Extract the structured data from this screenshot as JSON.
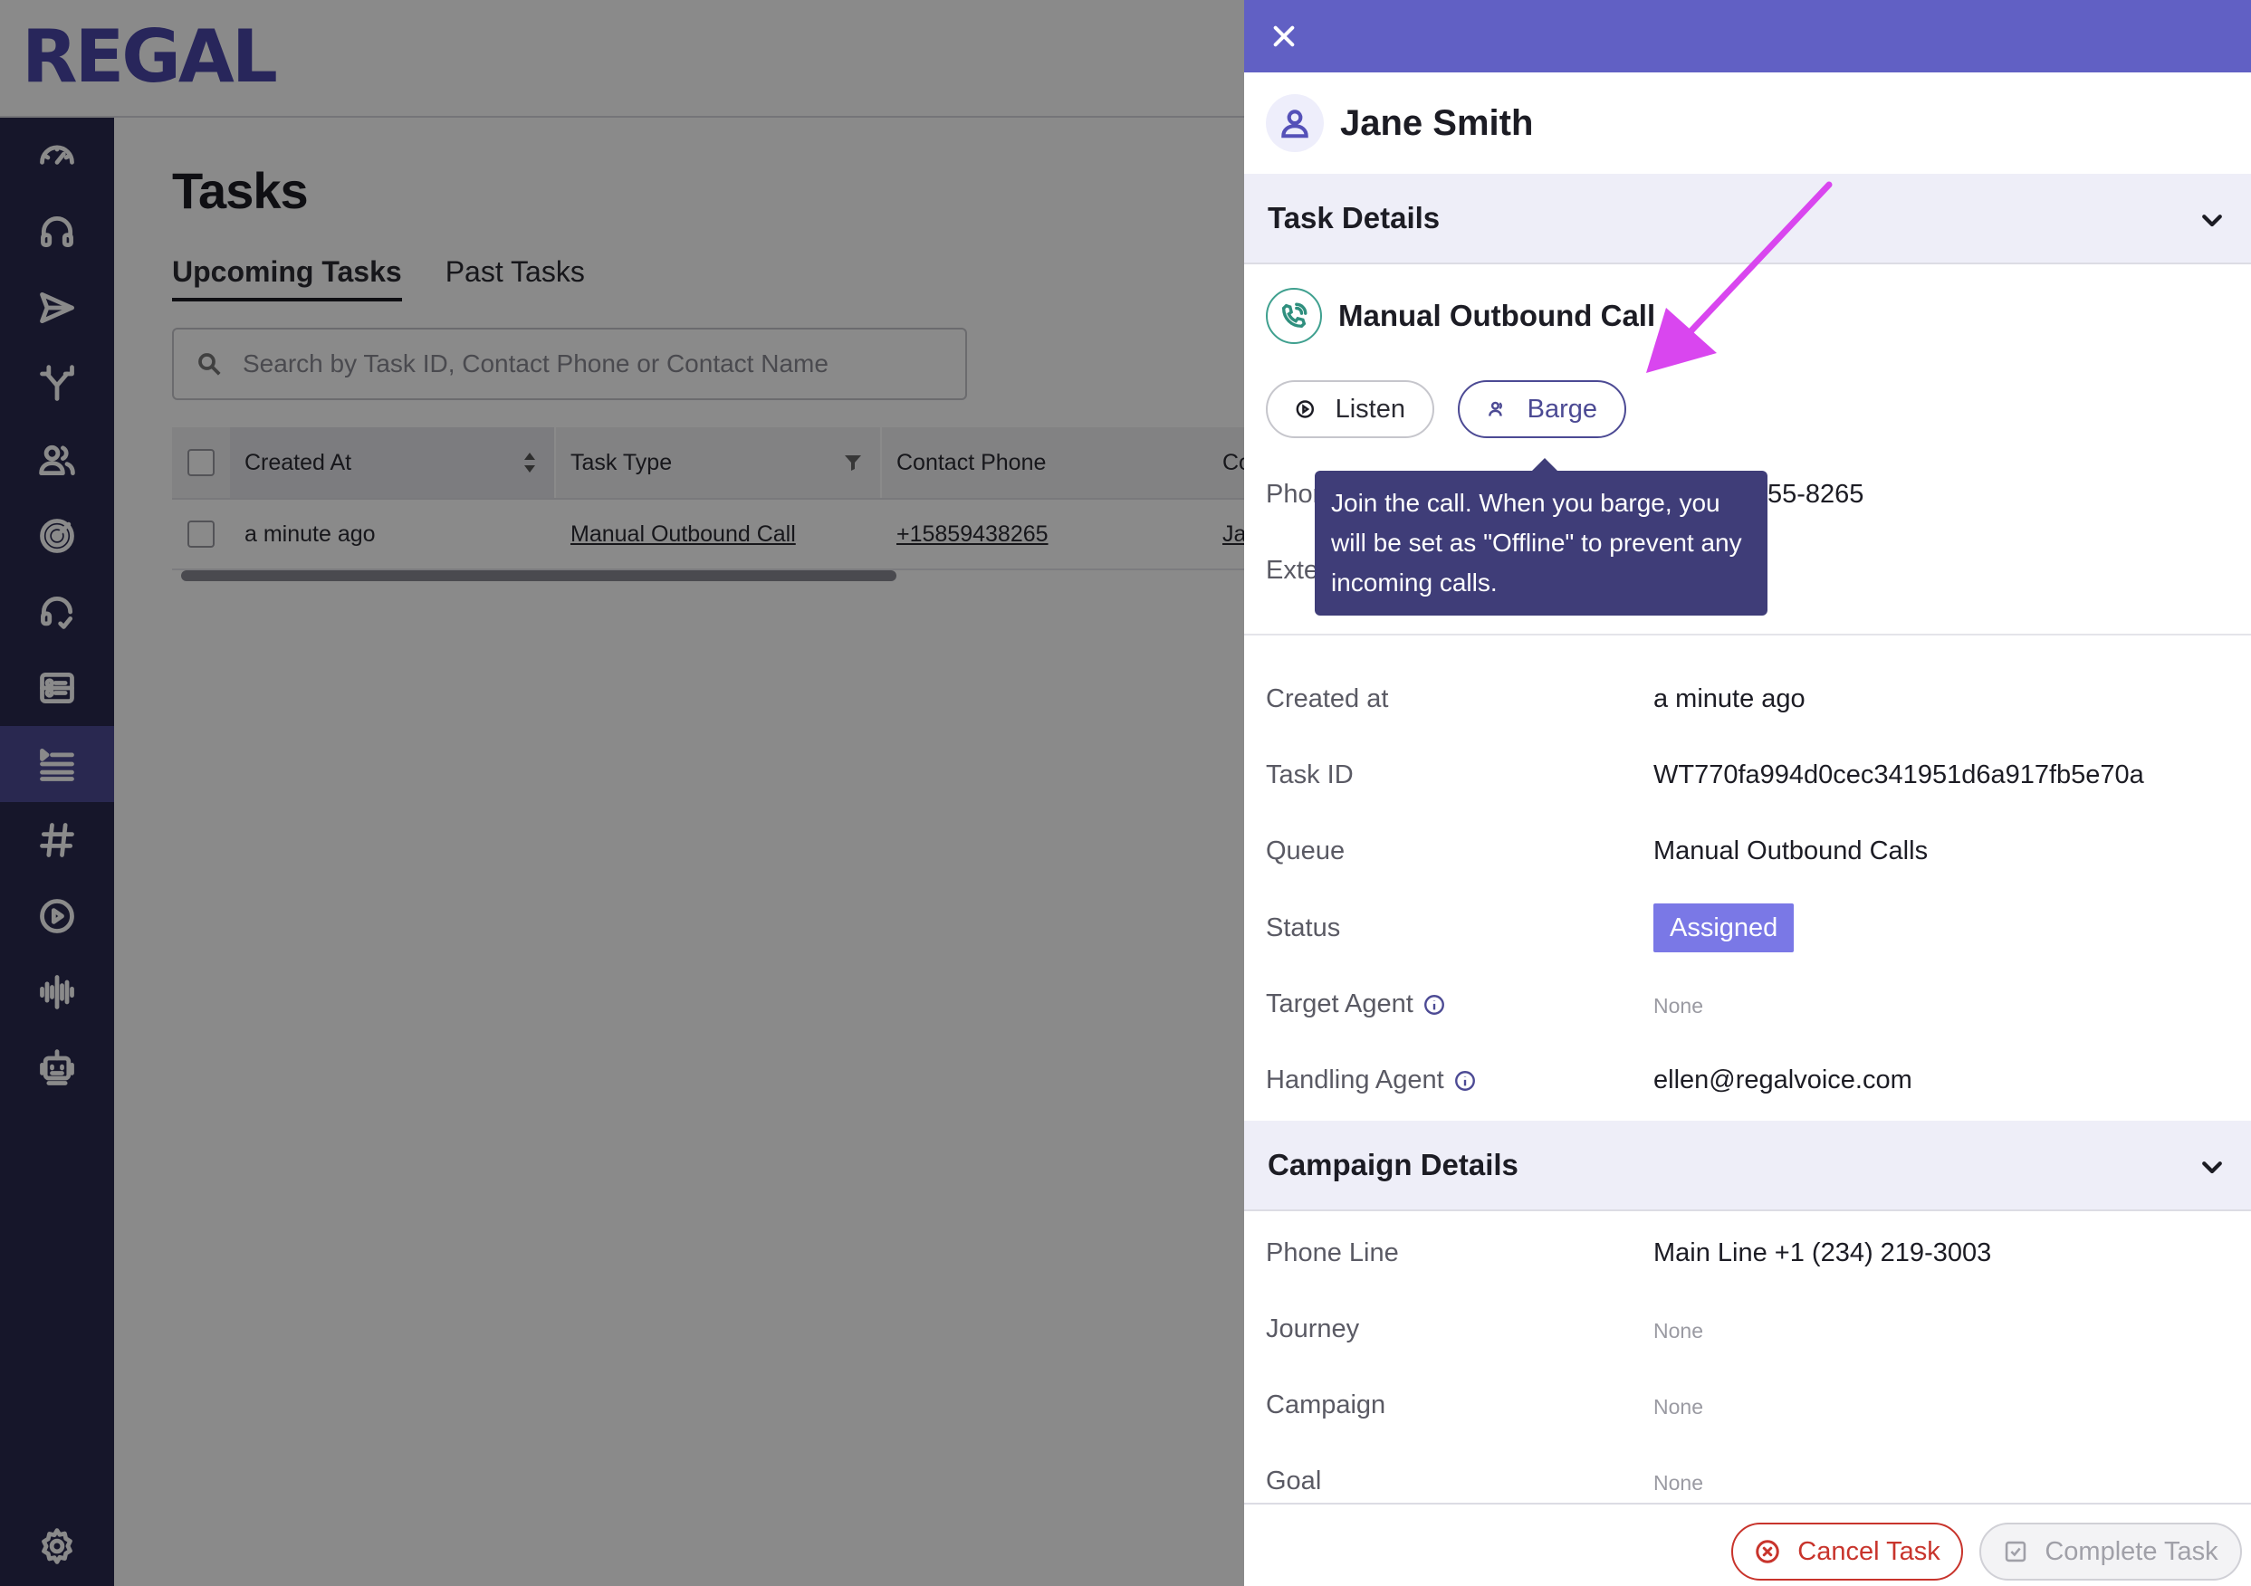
{
  "app": {
    "logo": "REGAL"
  },
  "sidebar": {
    "items": [
      {
        "icon": "dashboard-gauge-icon"
      },
      {
        "icon": "headset-icon"
      },
      {
        "icon": "send-icon"
      },
      {
        "icon": "branch-icon"
      },
      {
        "icon": "contacts-icon"
      },
      {
        "icon": "target-icon"
      },
      {
        "icon": "agent-headset-icon"
      },
      {
        "icon": "reports-icon"
      },
      {
        "icon": "tasks-list-icon",
        "active": true
      },
      {
        "icon": "hashtag-icon"
      },
      {
        "icon": "play-circle-icon"
      },
      {
        "icon": "audio-wave-icon"
      },
      {
        "icon": "robot-icon"
      },
      {
        "icon": "settings-gear-icon"
      }
    ]
  },
  "main": {
    "title": "Tasks",
    "tabs": [
      {
        "label": "Upcoming Tasks",
        "active": true
      },
      {
        "label": "Past Tasks",
        "active": false
      }
    ],
    "search": {
      "placeholder": "Search by Task ID, Contact Phone or Contact Name",
      "value": ""
    },
    "table": {
      "headers": [
        "Created At",
        "Task Type",
        "Contact Phone",
        "Co"
      ],
      "rows": [
        {
          "created_at": "a minute ago",
          "task_type": "Manual Outbound Call",
          "contact_phone": "+15859438265",
          "contact": "Ja"
        }
      ]
    }
  },
  "drawer": {
    "contact_name": "Jane Smith",
    "task_details": {
      "title": "Task Details",
      "task_kind": "Manual Outbound Call",
      "listen_label": "Listen",
      "barge_label": "Barge",
      "tooltip": "Join the call. When you barge, you will be set as \"Offline\" to prevent any incoming calls.",
      "phone_label_fragment": "Phor",
      "phone_value_fragment": "55-8265",
      "ext_label_fragment": "Exte"
    },
    "fields": {
      "created_at": {
        "label": "Created at",
        "value": "a minute ago"
      },
      "task_id": {
        "label": "Task ID",
        "value": "WT770fa994d0cec341951d6a917fb5e70a"
      },
      "queue": {
        "label": "Queue",
        "value": "Manual Outbound Calls"
      },
      "status": {
        "label": "Status",
        "value": "Assigned"
      },
      "target_agent": {
        "label": "Target Agent",
        "value": "None"
      },
      "handling_agent": {
        "label": "Handling Agent",
        "value": "ellen@regalvoice.com"
      }
    },
    "campaign_details": {
      "title": "Campaign Details",
      "phone_line": {
        "label": "Phone Line",
        "value": "Main Line +1 (234) 219-3003"
      },
      "journey": {
        "label": "Journey",
        "value": "None"
      },
      "campaign": {
        "label": "Campaign",
        "value": "None"
      },
      "goal": {
        "label": "Goal",
        "value": "None"
      }
    },
    "footer": {
      "cancel_label": "Cancel Task",
      "complete_label": "Complete Task"
    }
  },
  "colors": {
    "brand": "#4a46a8",
    "sidebar_bg": "#2a2a4e",
    "drawer_header": "#6160c4",
    "status_badge": "#7a78e6",
    "cancel": "#c8342c",
    "annotation_arrow": "#d946ef"
  }
}
